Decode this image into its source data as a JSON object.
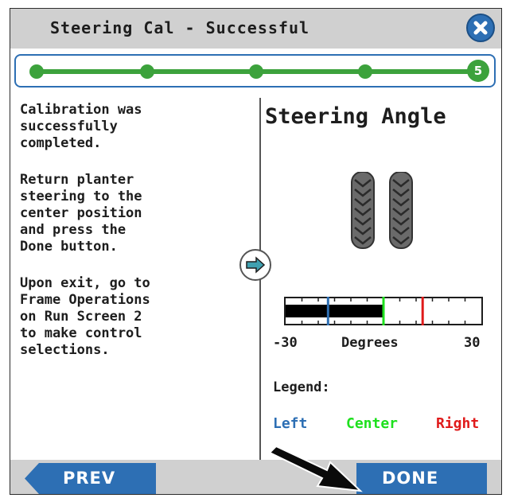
{
  "header": {
    "title": "Steering Cal - Successful",
    "close_icon": "close-icon"
  },
  "progress": {
    "total_steps": 5,
    "current_step": "5",
    "color": "#3ca23c"
  },
  "instructions": [
    "Calibration was\nsuccessfully\ncompleted.",
    "Return planter\nsteering to the\ncenter position\nand press the\nDone button.",
    "Upon exit, go to\nFrame Operations\non Run Screen 2\nto make control\nselections."
  ],
  "next_icon": "arrow-right-icon",
  "steering": {
    "title": "Steering Angle",
    "icon": "tires-icon",
    "gauge": {
      "min": -30,
      "max": 30,
      "left_value": -17,
      "center_value": 0,
      "right_value": 12,
      "fill_from": -30,
      "fill_to": 0
    },
    "min_label": "-30",
    "axis_label": "Degrees",
    "max_label": "30",
    "legend_label": "Legend:",
    "legend": {
      "left": "Left",
      "center": "Center",
      "right": "Right"
    },
    "colors": {
      "left": "#2d6fb4",
      "center": "#1ee01e",
      "right": "#e01b1b",
      "fill": "#000000"
    }
  },
  "footer": {
    "prev_label": "PREV",
    "done_label": "DONE",
    "button_color": "#2d6fb4"
  }
}
